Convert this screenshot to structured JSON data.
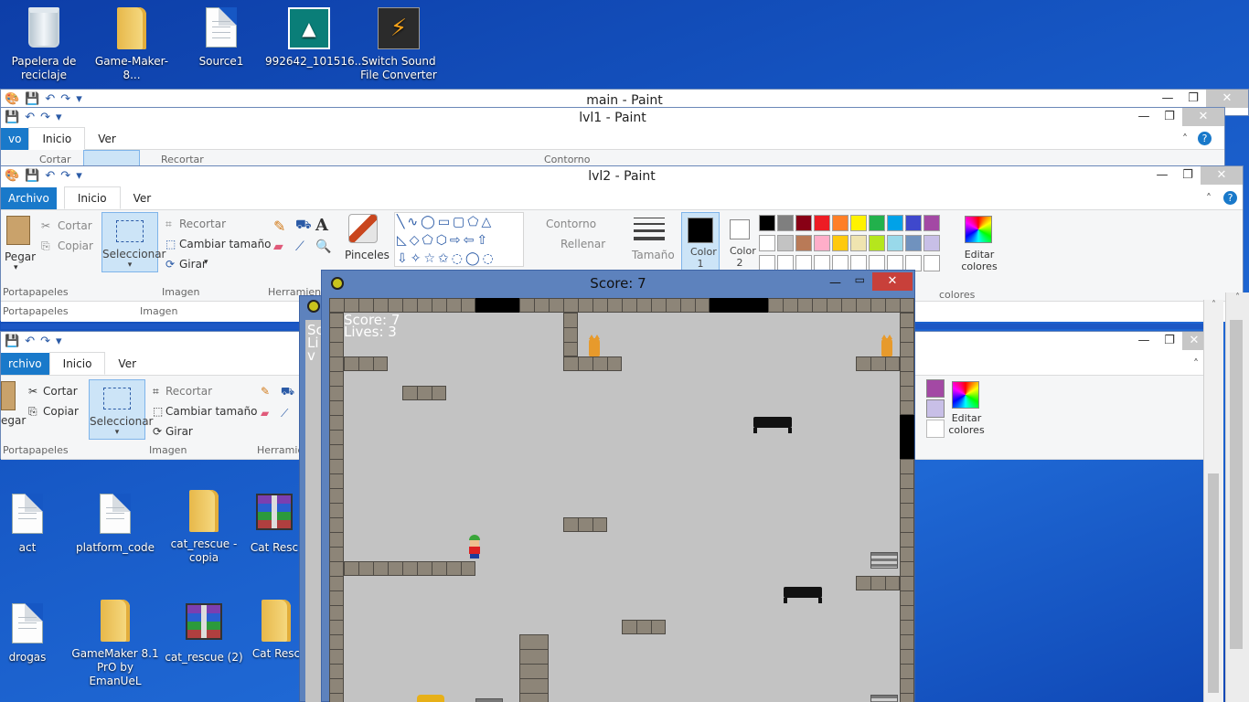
{
  "desktop_top_icons": [
    {
      "label": "Papelera de reciclaje",
      "icon": "recycle-bin-icon"
    },
    {
      "label": "Game-Maker-8...",
      "icon": "folder-icon"
    },
    {
      "label": "Source1",
      "icon": "document-icon"
    },
    {
      "label": "992642_101516...",
      "icon": "image-file-icon"
    },
    {
      "label": "Switch Sound File Converter",
      "icon": "switch-app-icon"
    }
  ],
  "desktop_bottom_icons": [
    {
      "label": "act",
      "icon": "document-icon"
    },
    {
      "label": "platform_code",
      "icon": "document-icon"
    },
    {
      "label": "cat_rescue - copia",
      "icon": "folder-icon"
    },
    {
      "label": "Cat Resc",
      "icon": "archive-icon"
    },
    {
      "label": "drogas",
      "icon": "document-icon"
    },
    {
      "label": "GameMaker 8.1 PrO by EmanUeL",
      "icon": "folder-icon"
    },
    {
      "label": "cat_rescue (2)",
      "icon": "archive-icon"
    },
    {
      "label": "Cat Resc",
      "icon": "folder-icon"
    }
  ],
  "paint_main": {
    "title": "main - Paint"
  },
  "paint_lvl1": {
    "title": "lvl1 - Paint",
    "tabs": [
      "vo",
      "Inicio",
      "Ver"
    ],
    "ribbon_partial": [
      "Cortar",
      "Recortar",
      "Contorno"
    ]
  },
  "paint_lvl2": {
    "title": "lvl2 - Paint",
    "tabs": {
      "file": "Archivo",
      "home": "Inicio",
      "view": "Ver"
    },
    "clipboard": {
      "paste": "Pegar",
      "cut": "Cortar",
      "copy": "Copiar",
      "group": "Portapapeles"
    },
    "image": {
      "select": "Seleccionar",
      "crop": "Recortar",
      "resize": "Cambiar tamaño",
      "rotate": "Girar",
      "group": "Imagen"
    },
    "tools": {
      "group": "Herramientas"
    },
    "brushes": "Pinceles",
    "shapes": {
      "outline": "Contorno",
      "fill": "Rellenar"
    },
    "size": "Tamaño",
    "color1": "Color 1",
    "color2": "Color 2",
    "edit_colors": "Editar colores",
    "palette_row1": [
      "#000000",
      "#7f7f7f",
      "#880015",
      "#ed1c24",
      "#ff7f27",
      "#fff200",
      "#22b14c",
      "#00a2e8",
      "#3f48cc",
      "#a349a4"
    ],
    "palette_row2": [
      "#ffffff",
      "#c3c3c3",
      "#b97a57",
      "#ffaec9",
      "#ffc90e",
      "#efe4b0",
      "#b5e61d",
      "#99d9ea",
      "#7092be",
      "#c8bfe7"
    ]
  },
  "paint_lvl3": {
    "tabs": {
      "file": "rchivo",
      "home": "Inicio",
      "view": "Ver"
    },
    "clipboard": {
      "paste": "egar",
      "cut": "Cortar",
      "copy": "Copiar",
      "group": "Portapapeles"
    },
    "image": {
      "select": "Seleccionar",
      "crop": "Recortar",
      "resize": "Cambiar tamaño",
      "rotate": "Girar",
      "group": "Imagen"
    },
    "tools_group": "Herramie",
    "edit_colors": "Editar colores",
    "group_behind": "Portapapeles",
    "image_behind": "Imagen",
    "colores_behind": "colores"
  },
  "game": {
    "title": "Score: 7",
    "score_text": "Score: 7",
    "lives_text": "Lives: 3",
    "behind_hud": "Sc Liv",
    "score": 7,
    "lives": 3
  }
}
